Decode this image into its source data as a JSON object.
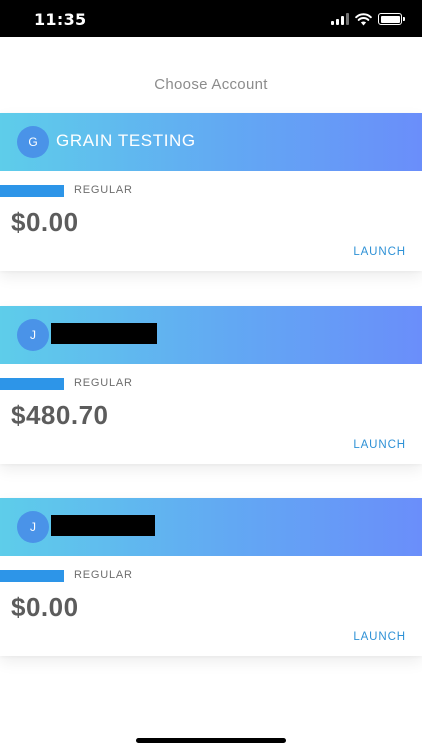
{
  "status_bar": {
    "time": "11:35",
    "icons": [
      "cellular-signal-icon",
      "wifi-icon",
      "battery-icon"
    ]
  },
  "page": {
    "title": "Choose Account"
  },
  "accounts": [
    {
      "avatar_letter": "G",
      "name": "GRAIN TESTING",
      "name_redacted": false,
      "type": "REGULAR",
      "balance": "$0.00",
      "action": "LAUNCH"
    },
    {
      "avatar_letter": "J",
      "name": "",
      "name_redacted": true,
      "type": "REGULAR",
      "balance": "$480.70",
      "action": "LAUNCH"
    },
    {
      "avatar_letter": "J",
      "name": "",
      "name_redacted": true,
      "type": "REGULAR",
      "balance": "$0.00",
      "action": "LAUNCH"
    }
  ],
  "colors": {
    "header_gradient_start": "#5ecdea",
    "header_gradient_end": "#6a8efa",
    "accent_bar": "#2d95e8",
    "launch_link": "#2e91d6",
    "avatar_bg": "#4a93e8"
  }
}
